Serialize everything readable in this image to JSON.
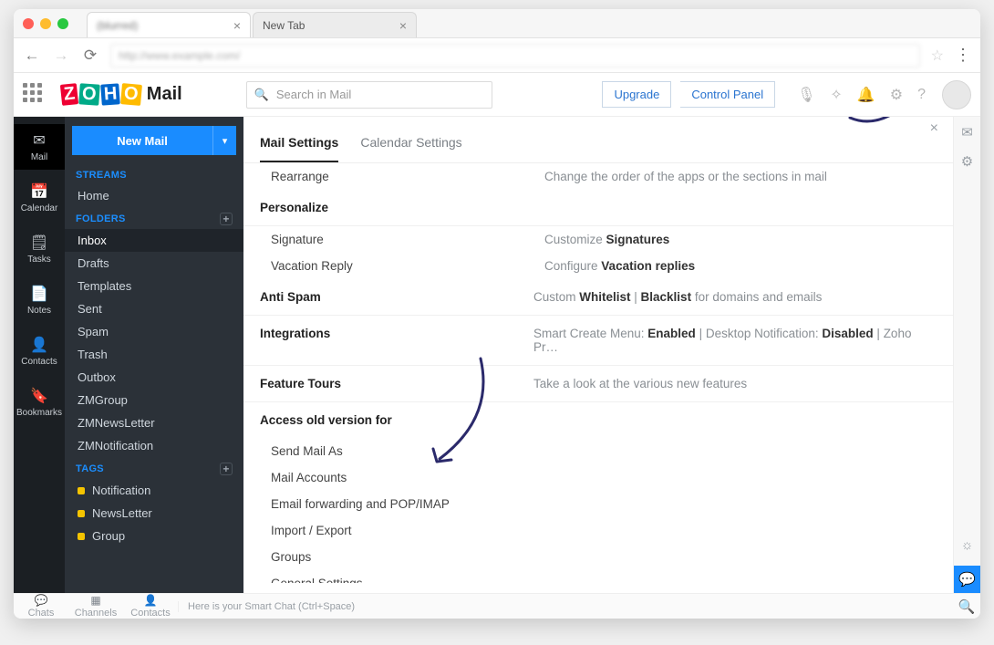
{
  "browser": {
    "tabs": [
      {
        "label": "(blurred)"
      },
      {
        "label": "New Tab"
      }
    ]
  },
  "app": {
    "logo_mail": "Mail",
    "search_placeholder": "Search in Mail",
    "upgrade": "Upgrade",
    "control_panel": "Control Panel"
  },
  "rail": {
    "items": [
      {
        "id": "mail",
        "label": "Mail"
      },
      {
        "id": "calendar",
        "label": "Calendar"
      },
      {
        "id": "tasks",
        "label": "Tasks"
      },
      {
        "id": "notes",
        "label": "Notes"
      },
      {
        "id": "contacts",
        "label": "Contacts"
      },
      {
        "id": "bookmarks",
        "label": "Bookmarks"
      }
    ]
  },
  "sidebar": {
    "new_mail": "New Mail",
    "streams_head": "STREAMS",
    "streams": [
      {
        "label": "Home"
      }
    ],
    "folders_head": "FOLDERS",
    "folders": [
      {
        "label": "Inbox"
      },
      {
        "label": "Drafts"
      },
      {
        "label": "Templates"
      },
      {
        "label": "Sent"
      },
      {
        "label": "Spam"
      },
      {
        "label": "Trash"
      },
      {
        "label": "Outbox"
      },
      {
        "label": "ZMGroup"
      },
      {
        "label": "ZMNewsLetter"
      },
      {
        "label": "ZMNotification"
      }
    ],
    "tags_head": "TAGS",
    "tags": [
      {
        "label": "Notification"
      },
      {
        "label": "NewsLetter"
      },
      {
        "label": "Group"
      }
    ]
  },
  "settings": {
    "tab_mail": "Mail Settings",
    "tab_cal": "Calendar Settings",
    "rows": {
      "rearrange": {
        "k": "Rearrange",
        "v": "Change the order of the apps or the sections in mail"
      },
      "personalize_head": "Personalize",
      "signature": {
        "k": "Signature",
        "v_pre": "Customize ",
        "v_b": "Signatures"
      },
      "vacation": {
        "k": "Vacation Reply",
        "v_pre": "Configure ",
        "v_b": "Vacation replies"
      },
      "antispam": {
        "k": "Anti Spam",
        "v_pre": "Custom ",
        "v_b1": "Whitelist",
        "sep": "  |  ",
        "v_b2": "Blacklist",
        "v_post": " for domains and emails"
      },
      "integrations": {
        "k": "Integrations",
        "v_a": "Smart Create Menu: ",
        "v_a_b": "Enabled",
        "sep": "  |  ",
        "v_b": "Desktop Notification: ",
        "v_b_b": "Disabled",
        "sep2": "  |  ",
        "v_c": "Zoho Pr…"
      },
      "tours": {
        "k": "Feature Tours",
        "v": "Take a look at the various new features"
      },
      "access_head": "Access old version for",
      "send_as": "Send Mail As",
      "mail_accounts": "Mail Accounts",
      "fwd": "Email forwarding and POP/IMAP",
      "import": "Import / Export",
      "groups": "Groups",
      "general": "General Settings"
    }
  },
  "footer": {
    "chats": "Chats",
    "channels": "Channels",
    "contacts": "Contacts",
    "hint": "Here is your Smart Chat (Ctrl+Space)"
  }
}
